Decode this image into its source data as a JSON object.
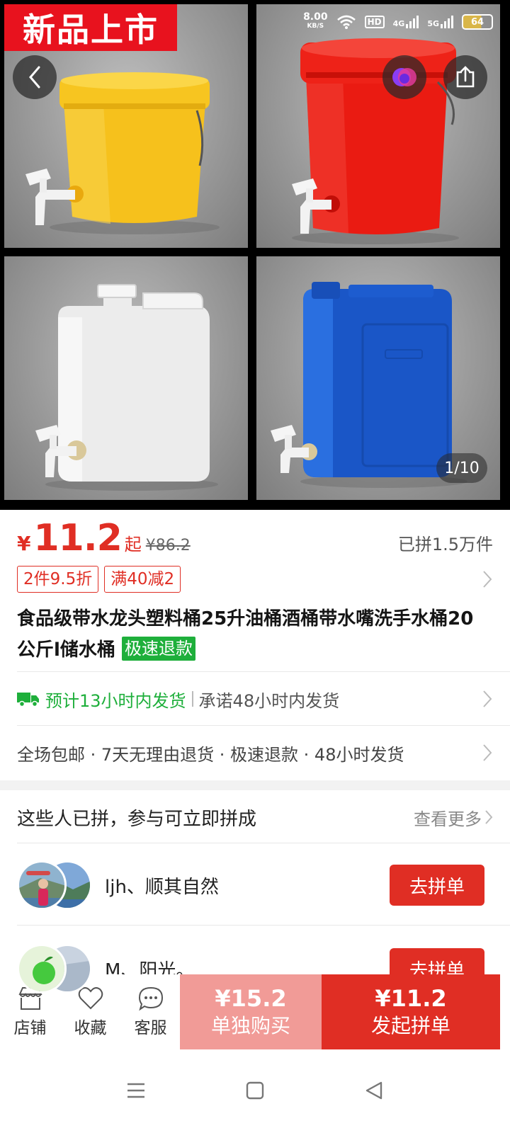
{
  "hero": {
    "new_tag": "新品上市",
    "status": {
      "net_speed": "8.00",
      "net_unit": "KB/S",
      "hd": "HD",
      "sig1": "4G",
      "sig2": "5G",
      "battery": "64"
    },
    "page_counter": "1/10",
    "products": [
      "yellow-bucket",
      "red-bucket",
      "white-jerrycan",
      "blue-jerrycan"
    ]
  },
  "price": {
    "currency": "¥",
    "amount": "11.2",
    "from": "起",
    "original": "¥86.2",
    "sold": "已拼1.5万件"
  },
  "coupons": [
    "2件9.5折",
    "满40减2"
  ],
  "title": {
    "text": "食品级带水龙头塑料桶25升油桶酒桶带水嘴洗手水桶20公斤l储水桶",
    "badge": "极速退款"
  },
  "shipping": {
    "estimate": "预计13小时内发货",
    "promise": "承诺48小时内发货"
  },
  "services": "全场包邮 · 7天无理由退货 · 极速退款 · 48小时发货",
  "group": {
    "heading": "这些人已拼，参与可立即拼成",
    "more": "查看更多",
    "rows": [
      {
        "names": "ljh、顺其自然",
        "button": "去拼单"
      },
      {
        "names": "M、阳光。",
        "button": "去拼单"
      }
    ]
  },
  "action_bar": {
    "store": "店铺",
    "favorite": "收藏",
    "service": "客服",
    "solo_price": "¥15.2",
    "solo_label": "单独购买",
    "group_price": "¥11.2",
    "group_label": "发起拼单"
  },
  "colors": {
    "brand_red": "#e02e24",
    "fast_green": "#1eaf3b",
    "solo_pink": "#f19b97"
  }
}
